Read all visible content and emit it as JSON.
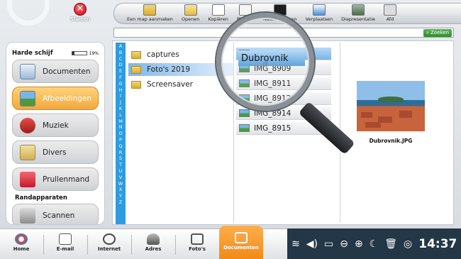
{
  "window": {
    "close_label": "Sluiten"
  },
  "toolbar": {
    "items": [
      {
        "label": "Een map aanmaken",
        "icon": "new-folder-icon"
      },
      {
        "label": "Openen",
        "icon": "open-icon"
      },
      {
        "label": "Kopiëren",
        "icon": "copy-icon"
      },
      {
        "label": "Plakken",
        "icon": "paste-icon"
      },
      {
        "label": "Naam wijzigen",
        "icon": "rename-icon"
      },
      {
        "label": "Verplaatsen",
        "icon": "move-icon"
      },
      {
        "label": "Diapresentatie",
        "icon": "slideshow-icon"
      },
      {
        "label": "Afd",
        "icon": "print-icon"
      }
    ]
  },
  "search": {
    "value": "",
    "button_label": "Zoeken"
  },
  "sidebar": {
    "disk": {
      "label": "Harde schijf",
      "percent_label": "19%",
      "used_fraction": 0.19
    },
    "items": [
      {
        "label": "Documenten",
        "icon": "documents-icon",
        "active": false
      },
      {
        "label": "Afbeeldingen",
        "icon": "pictures-icon",
        "active": true
      },
      {
        "label": "Muziek",
        "icon": "music-icon",
        "active": false
      },
      {
        "label": "Divers",
        "icon": "folder-icon",
        "active": false
      },
      {
        "label": "Prullenmand",
        "icon": "trash-icon",
        "active": false
      }
    ],
    "peripherals_label": "Randapparaten",
    "peripheral_items": [
      {
        "label": "Scannen",
        "icon": "scanner-icon"
      }
    ]
  },
  "alphabet": [
    "A",
    "B",
    "C",
    "D",
    "E",
    "F",
    "G",
    "H",
    "I",
    "J",
    "K",
    "L",
    "M",
    "N",
    "O",
    "P",
    "Q",
    "R",
    "S",
    "T",
    "U",
    "V",
    "W",
    "X",
    "Y",
    "Z"
  ],
  "folders": [
    {
      "name": "captures",
      "selected": false
    },
    {
      "name": "Foto's 2019",
      "selected": true
    },
    {
      "name": "Screensaver",
      "selected": false
    }
  ],
  "files": [
    {
      "name": "Dubrovnik",
      "selected": true
    },
    {
      "name": "IMG_8909",
      "selected": false
    },
    {
      "name": "IMG_8911",
      "selected": false
    },
    {
      "name": "IMG_8912",
      "selected": false
    },
    {
      "name": "IMG_8914",
      "selected": false
    },
    {
      "name": "IMG_8915",
      "selected": false
    }
  ],
  "preview": {
    "filename": "Dubrovnik.JPG"
  },
  "taskbar": {
    "items": [
      {
        "label": "Home",
        "icon": "home-icon",
        "active": false
      },
      {
        "label": "E-mail",
        "icon": "email-icon",
        "active": false
      },
      {
        "label": "Internet",
        "icon": "globe-icon",
        "active": false
      },
      {
        "label": "Adres",
        "icon": "contacts-icon",
        "active": false
      },
      {
        "label": "Foto's",
        "icon": "camera-icon",
        "active": false
      },
      {
        "label": "Documenten",
        "icon": "documents-icon",
        "active": true
      }
    ],
    "clock": "14:37"
  },
  "colors": {
    "accent_orange": "#f4a83a",
    "selection_blue": "#79b5e6",
    "alpha_blue": "#2f9be0",
    "tray_bg": "#243746"
  }
}
